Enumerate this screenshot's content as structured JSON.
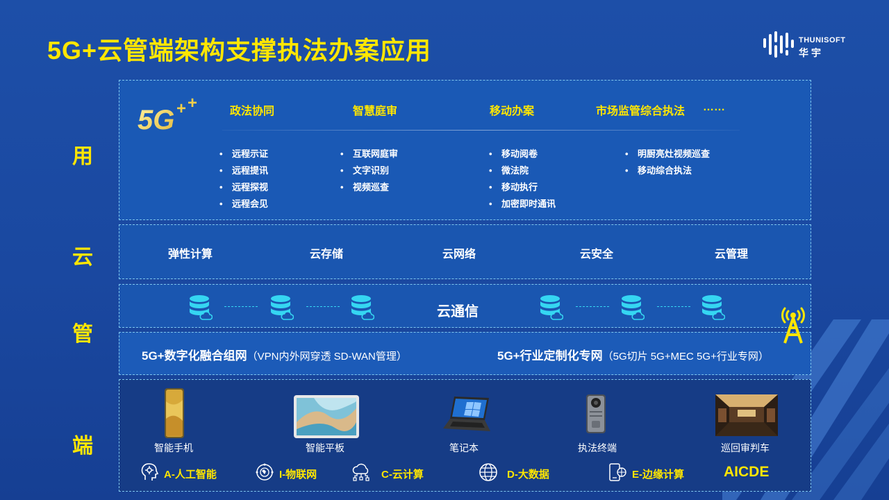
{
  "title": "5G+云管端架构支撑执法办案应用",
  "logo": {
    "text_en": "THUNISOFT",
    "text_cn": "华宇"
  },
  "side_labels": [
    "用",
    "云",
    "管",
    "端"
  ],
  "app_layer": {
    "badge": "5G++",
    "categories": [
      {
        "name": "政法协同",
        "items": [
          "远程示证",
          "远程提讯",
          "远程探视",
          "远程会见"
        ]
      },
      {
        "name": "智慧庭审",
        "items": [
          "互联网庭审",
          "文字识别",
          "视频巡查"
        ]
      },
      {
        "name": "移动办案",
        "items": [
          "移动阅卷",
          "微法院",
          "移动执行",
          "加密即时通讯"
        ]
      },
      {
        "name": "市场监管综合执法",
        "items": [
          "明厨亮灶视频巡查",
          "移动综合执法"
        ]
      }
    ],
    "more": "……"
  },
  "cloud_layer": {
    "items": [
      "弹性计算",
      "云存储",
      "云网络",
      "云安全",
      "云管理"
    ]
  },
  "comm_layer": {
    "label": "云通信"
  },
  "net_layer": {
    "left_main": "5G+数字化融合组网",
    "left_sub": "（VPN内外网穿透 SD-WAN管理）",
    "right_main": "5G+行业定制化专网",
    "right_sub": "（5G切片  5G+MEC  5G+行业专网）"
  },
  "end_layer": {
    "devices": [
      "智能手机",
      "智能平板",
      "笔记本",
      "执法终端",
      "巡回审判车"
    ],
    "aicde": [
      "A-人工智能",
      "I-物联网",
      "C-云计算",
      "D-大数据",
      "E-边缘计算"
    ],
    "aicde_title": "AICDE"
  },
  "colors": {
    "accent": "#ffe600",
    "cyan": "#35d6f2",
    "background": "#1b4ba4"
  }
}
